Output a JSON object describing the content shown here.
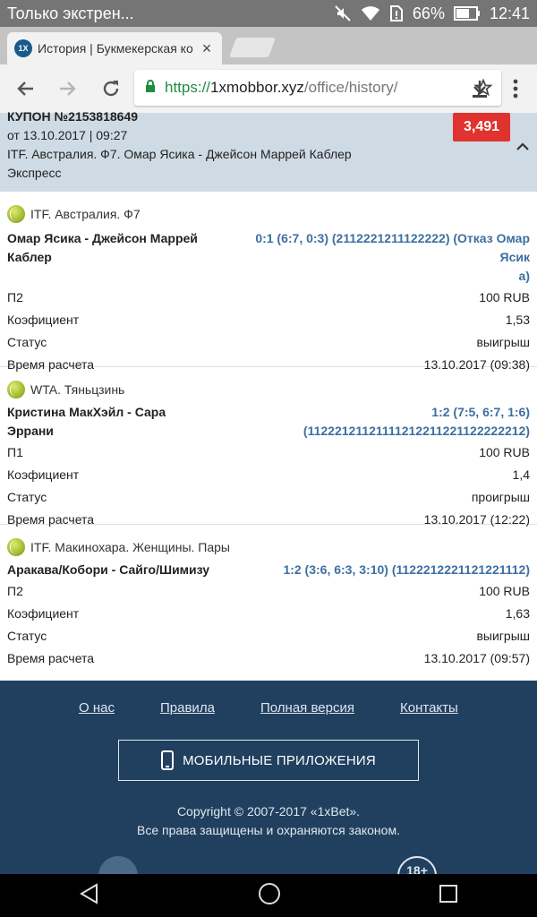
{
  "status_bar": {
    "notification": "Только экстрен...",
    "battery": "66%",
    "time": "12:41"
  },
  "tab": {
    "favicon": "1X",
    "title": "История | Букмекерская ко",
    "close": "×"
  },
  "toolbar": {
    "url_scheme": "https://",
    "url_host": "1xmobbor.xyz",
    "url_path": "/office/history/"
  },
  "coupon": {
    "number": "КУПОН №2153818649",
    "date": "от 13.10.2017 | 09:27",
    "event": "ITF. Австралия. Ф7. Омар Ясика - Джейсон Маррей Каблер",
    "type": "Экспресс",
    "coefficient": "3,491"
  },
  "bets": [
    {
      "league": "ITF. Австралия. Ф7",
      "event": [
        "Омар Ясика - Джейсон Маррей",
        "Каблер"
      ],
      "score": [
        "0:1 (6:7, 0:3) (2112221211122222) (Отказ Омар Ясик",
        "а)"
      ],
      "pick_label": "П2",
      "stake": "100 RUB",
      "coef_label": "Коэфициент",
      "coef": "1,53",
      "status_label": "Статус",
      "status": "выигрыш",
      "time_label": "Время расчета",
      "time": "13.10.2017 (09:38)"
    },
    {
      "league": "WTA. Тяньцзинь",
      "event": [
        "Кристина МакХэйл - Сара Эррани"
      ],
      "score": [
        "1:2 (7:5, 6:7, 1:6) (11222121121111212211221122222212)"
      ],
      "pick_label": "П1",
      "stake": "100 RUB",
      "coef_label": "Коэфициент",
      "coef": "1,4",
      "status_label": "Статус",
      "status": "проигрыш",
      "time_label": "Время расчета",
      "time": "13.10.2017 (12:22)"
    },
    {
      "league": "ITF. Макинохара. Женщины. Пары",
      "event": [
        "Аракава/Кобори - Сайго/Шимизу"
      ],
      "score": [
        "1:2 (3:6, 6:3, 3:10) (1122212221121221112)"
      ],
      "pick_label": "П2",
      "stake": "100 RUB",
      "coef_label": "Коэфициент",
      "coef": "1,63",
      "status_label": "Статус",
      "status": "выигрыш",
      "time_label": "Время расчета",
      "time": "13.10.2017 (09:57)"
    }
  ],
  "footer": {
    "links": [
      "О нас",
      "Правила",
      "Полная версия",
      "Контакты"
    ],
    "apps_button": "МОБИЛЬНЫЕ ПРИЛОЖЕНИЯ",
    "copyright": "Copyright © 2007-2017 «1xBet».",
    "rights": "Все права защищены и охраняются законом.",
    "age_badge": "18+"
  },
  "colors": {
    "status_bar": "#757575",
    "coupon_bg": "#cfdbe4",
    "badge_red": "#e0322e",
    "score_blue": "#3d6fa2",
    "footer_bg": "#21405f",
    "url_green": "#1e8e3e"
  },
  "icons": [
    "mute-icon",
    "wifi-icon",
    "sim-icon",
    "battery-icon",
    "back-icon",
    "forward-icon",
    "reload-icon",
    "lock-icon",
    "star-icon",
    "download-icon",
    "menu-icon",
    "chevron-up-icon",
    "tennis-ball-icon",
    "phone-icon",
    "nav-back-icon",
    "nav-home-icon",
    "nav-recents-icon"
  ]
}
